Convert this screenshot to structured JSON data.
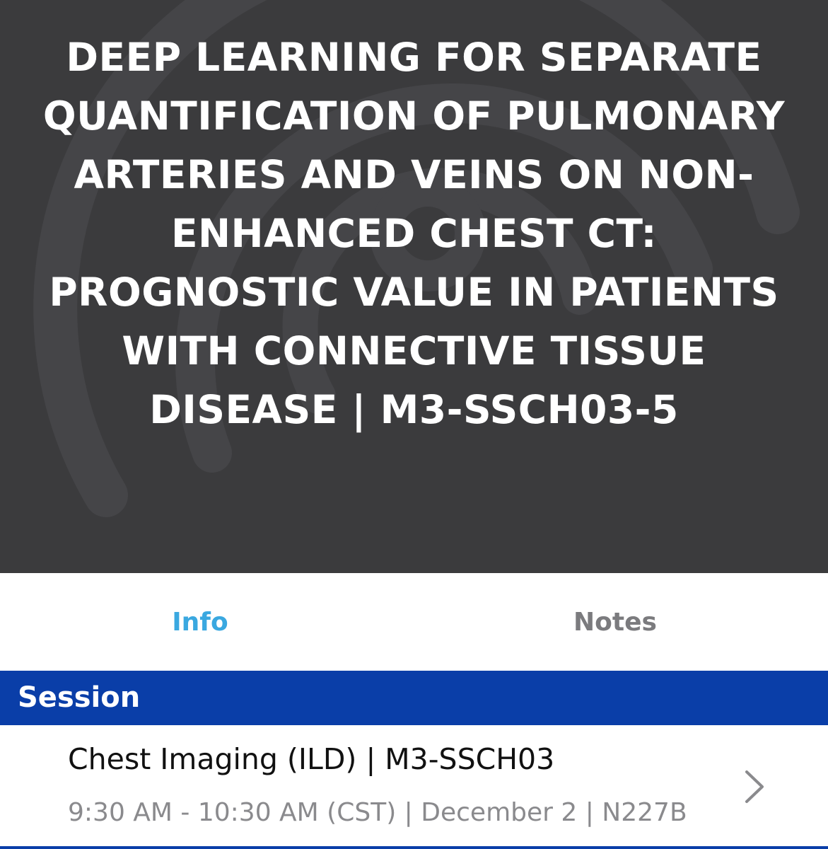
{
  "header": {
    "title": "DEEP LEARNING FOR SEPARATE QUANTIFICATION OF PULMONARY ARTERIES AND VEINS ON NON-ENHANCED CHEST CT: PROGNOSTIC VALUE IN PATIENTS WITH CONNECTIVE TISSUE DISEASE | M3-SSCH03-5",
    "background_color": "#3b3b3d",
    "background_icon": "concentric-ring-logo-icon"
  },
  "tabs": [
    {
      "label": "Info",
      "active": true,
      "color": "#3aa8e0"
    },
    {
      "label": "Notes",
      "active": false,
      "color": "#7b7b7e"
    }
  ],
  "section": {
    "title": "Session",
    "color": "#0a3ea8"
  },
  "session": {
    "name": "Chest Imaging (ILD) | M3-SSCH03",
    "meta": "9:30 AM - 10:30 AM (CST) | December 2 | N227B",
    "chevron_icon": "chevron-right-icon"
  }
}
